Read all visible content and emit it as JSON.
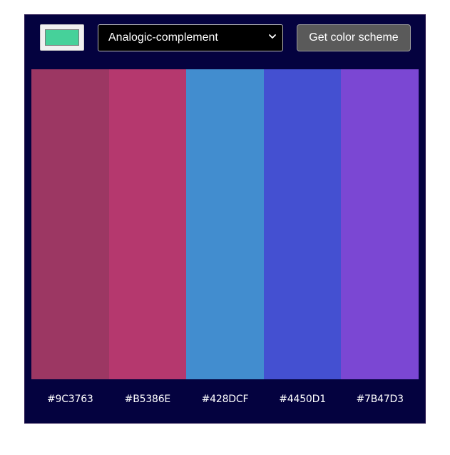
{
  "toolbar": {
    "seed_color": "#46d19a",
    "scheme_mode": "Analogic-complement",
    "get_button_label": "Get color scheme"
  },
  "palette": {
    "colors": [
      {
        "hex": "#9C3763",
        "color": "#9C3763"
      },
      {
        "hex": "#B5386E",
        "color": "#B5386E"
      },
      {
        "hex": "#428DCF",
        "color": "#428DCF"
      },
      {
        "hex": "#4450D1",
        "color": "#4450D1"
      },
      {
        "hex": "#7B47D3",
        "color": "#7B47D3"
      }
    ]
  },
  "colors": {
    "app_background": "#04023f"
  }
}
